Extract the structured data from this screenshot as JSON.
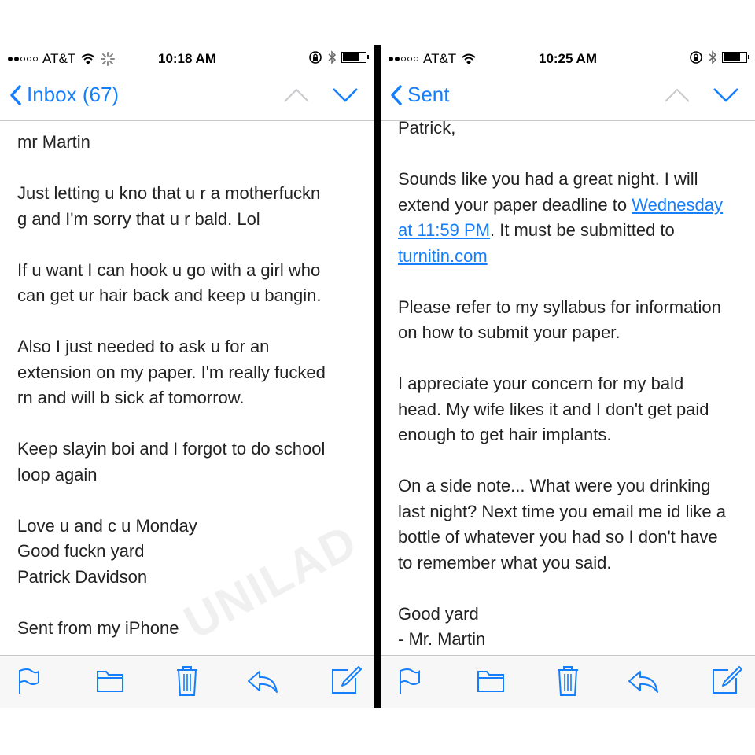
{
  "left": {
    "status": {
      "carrier": "AT&T",
      "time": "10:18 AM"
    },
    "nav": {
      "back_label": "Inbox (67)"
    },
    "paragraphs": [
      "mr Martin",
      "Just letting u kno that u r a motherfuckn\ng and I'm sorry that u r bald. Lol",
      "If u want I can hook u go with a girl who\ncan get ur hair back and keep u bangin.",
      "Also I just needed to ask u for an\nextension on my paper. I'm really fucked\nrn and will b sick af tomorrow.",
      "Keep slayin boi and I forgot to do school\nloop again",
      "Love u and c u Monday\nGood fuckn yard\nPatrick Davidson",
      "Sent from my iPhone"
    ],
    "watermark": "UNILAD"
  },
  "right": {
    "status": {
      "carrier": "AT&T",
      "time": "10:25 AM"
    },
    "nav": {
      "back_label": "Sent"
    },
    "greeting": "Patrick,",
    "p2": {
      "text_before": "Sounds like you had a great night. I will\nextend your paper deadline to ",
      "link_date": "Wednesday\nat 11:59 PM",
      "text_middle": ". It must be submitted to\n",
      "link_site": "turnitin.com"
    },
    "paragraphs": [
      "Please refer to my syllabus for information\non how to submit your paper.",
      "I appreciate your concern for my bald\nhead. My wife likes it and I don't get paid\nenough to get hair implants.",
      "On a side note... What were you drinking\nlast night? Next time you email me id like a\nbottle of whatever you had so I don't have\nto remember what you said.",
      "Good yard\n- Mr. Martin"
    ]
  },
  "icons": {
    "status": [
      "signal-dots-icon",
      "wifi-icon",
      "activity-spinner-icon",
      "lock-rotation-icon",
      "bluetooth-icon",
      "battery-icon"
    ],
    "nav": [
      "chevron-left-icon",
      "chevron-up-icon",
      "chevron-down-icon"
    ],
    "toolbar": [
      "flag-icon",
      "folder-icon",
      "trash-icon",
      "reply-icon",
      "compose-icon"
    ]
  },
  "colors": {
    "accent": "#157efb",
    "text": "#222222",
    "divider": "#000000",
    "toolbar_bg": "#f7f7f7"
  }
}
